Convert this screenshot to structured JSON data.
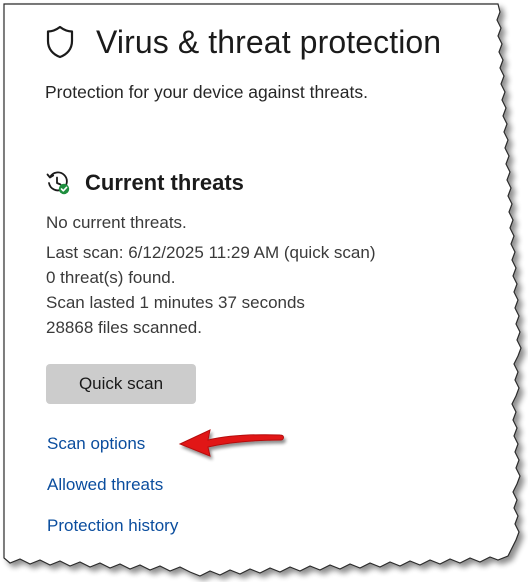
{
  "page": {
    "title": "Virus & threat protection",
    "subtitle": "Protection for your device against threats."
  },
  "current_threats": {
    "heading": "Current threats",
    "status_lines": [
      "No current threats.",
      "Last scan: 6/12/2025 11:29 AM (quick scan)",
      "0 threat(s) found.",
      "Scan lasted 1 minutes 37 seconds",
      "28868 files scanned."
    ],
    "quick_scan_label": "Quick scan"
  },
  "links": {
    "scan_options": "Scan options",
    "allowed_threats": "Allowed threats",
    "protection_history": "Protection history"
  },
  "icons": {
    "header": "shield-icon",
    "section": "clock-check-icon",
    "annotation": "red-arrow-icon"
  },
  "colors": {
    "link": "#0a4d9e",
    "button_bg": "#cccccc",
    "check_green": "#1e8e3e",
    "annotation_arrow": "#e11414"
  }
}
